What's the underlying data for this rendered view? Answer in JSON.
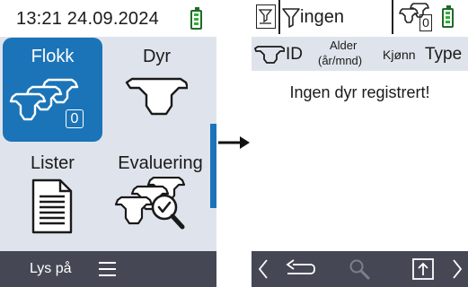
{
  "left_screen": {
    "status": {
      "clock": "13:21 24.09.2024",
      "battery_icon": "battery-full-icon"
    },
    "tiles": [
      {
        "label": "Flokk",
        "icon": "herd-icon",
        "badge": "0",
        "active": true
      },
      {
        "label": "Dyr",
        "icon": "cow-head-icon",
        "active": false
      },
      {
        "label": "Lister",
        "icon": "document-list-icon",
        "active": false
      },
      {
        "label": "Evaluering",
        "icon": "herd-evaluation-icon",
        "active": false
      }
    ],
    "bottom_bar": {
      "light_label": "Lys på",
      "menu_icon": "hamburger-menu-icon"
    }
  },
  "right_screen": {
    "header": {
      "filter_value": "ingen",
      "herd_count": "0"
    },
    "columns": [
      {
        "label": "ID"
      },
      {
        "label": "Alder",
        "sub": "(år/mnd)"
      },
      {
        "label": "Kjønn"
      },
      {
        "label": "Type"
      }
    ],
    "empty_message": "Ingen dyr registrert!",
    "bottom_bar": {
      "icons": [
        "chevron-left-icon",
        "back-arrow-icon",
        "search-icon",
        "upload-icon",
        "chevron-right-icon"
      ]
    }
  },
  "colors": {
    "accent": "#1b74b8",
    "panel_bg": "#dfe4ec",
    "bar_bg": "#454854",
    "battery": "#2bb236"
  }
}
